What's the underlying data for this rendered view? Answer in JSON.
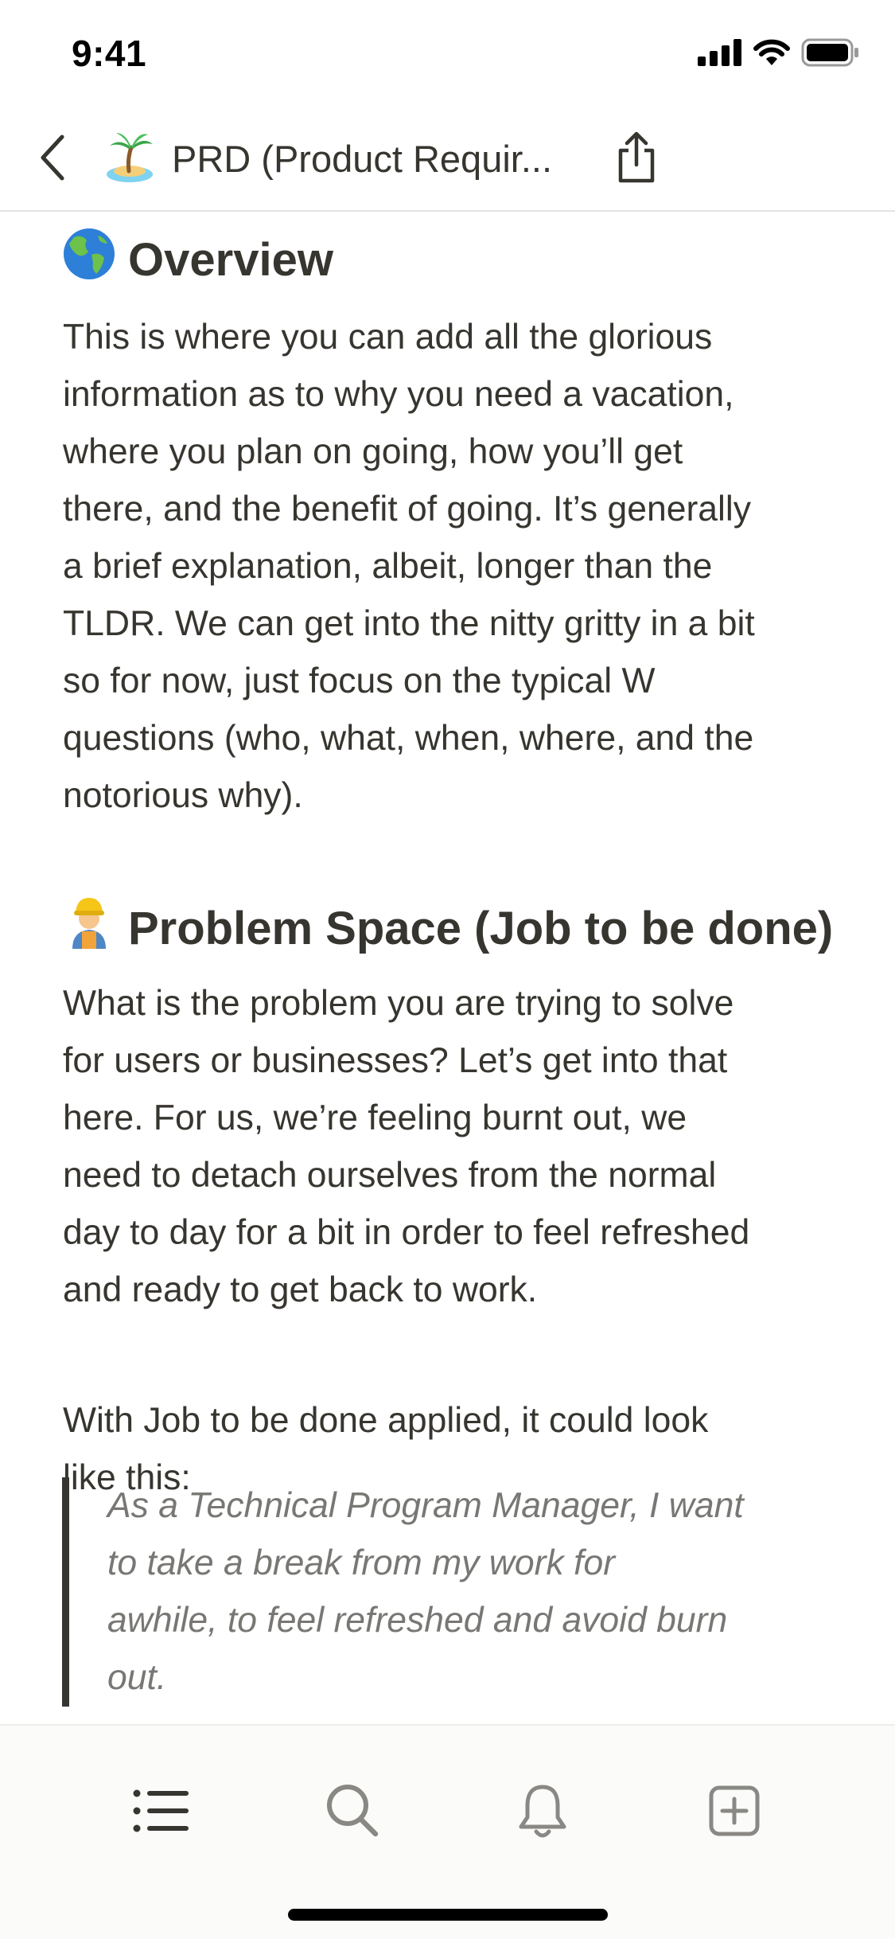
{
  "status_bar": {
    "time": "9:41",
    "icons": [
      "cellular-signal-icon",
      "wifi-icon",
      "battery-icon"
    ]
  },
  "nav": {
    "back_icon": "chevron-left-icon",
    "page_icon": "desert-island-emoji",
    "title": "PRD (Product Requir...",
    "share_icon": "share-icon"
  },
  "sections": {
    "overview": {
      "heading": "Overview",
      "emoji": "globe-emoji",
      "body_lines": [
        "This is where you can add all the glorious",
        "information as to why you need a vacation,",
        "where you plan on going, how you’ll get",
        "there, and the benefit of going. It’s generally",
        "a brief explanation, albeit, longer than the",
        "TLDR. We can get into the nitty gritty in a bit",
        "so for now, just focus on the typical W",
        "questions (who, what, when, where, and the",
        "notorious why)."
      ]
    },
    "problem": {
      "heading": "Problem Space (Job to be done)",
      "emoji": "construction-worker-emoji",
      "body_lines": [
        "What is the problem you are trying to solve",
        "for users or businesses? Let’s get into that",
        "here. For us, we’re feeling burnt out, we",
        "need to detach ourselves from the normal",
        "day to day for a bit in order to feel refreshed",
        "and ready to get back to work."
      ],
      "jtbd_lines": [
        "With Job to be done applied, it could look",
        "like this:"
      ],
      "quote_lines": [
        "As a Technical Program Manager, I want",
        "to take a break from my work for",
        "awhile, to feel refreshed and avoid burn",
        "out."
      ]
    }
  },
  "toolbar": {
    "items": [
      "list-icon",
      "search-icon",
      "bell-icon",
      "new-page-icon"
    ]
  },
  "colors": {
    "text": "#37352f",
    "quote_text": "#787774",
    "toolbar_bg": "#fbfbfa",
    "divider": "#e3e3e1"
  }
}
